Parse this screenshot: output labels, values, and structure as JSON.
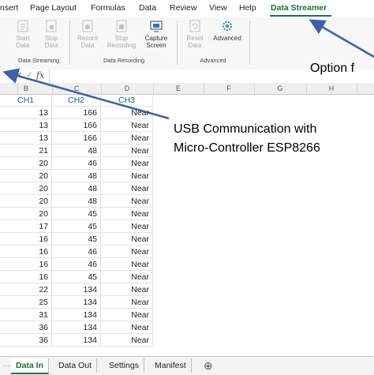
{
  "menu": [
    "nsert",
    "Page Layout",
    "Formulas",
    "Data",
    "Review",
    "View",
    "Help",
    "Data Streamer"
  ],
  "ribbon": {
    "buttons": [
      "Start\nData",
      "Stop\nData",
      "Record\nData",
      "Stop\nRecording",
      "Capture\nScreen",
      "Reset\nData",
      "Advanced"
    ],
    "groups": [
      "Data Streaming",
      "Data Recording",
      "Advanced"
    ]
  },
  "formula_bar": {
    "fx": "fx"
  },
  "columns": [
    "B",
    "C",
    "D",
    "E",
    "F",
    "G",
    "H"
  ],
  "table": {
    "headers": [
      "CH1",
      "CH2",
      "CH3"
    ],
    "rows": [
      [
        "13",
        "166",
        "Near"
      ],
      [
        "13",
        "166",
        "Near"
      ],
      [
        "13",
        "166",
        "Near"
      ],
      [
        "21",
        "48",
        "Near"
      ],
      [
        "20",
        "46",
        "Near"
      ],
      [
        "20",
        "48",
        "Near"
      ],
      [
        "20",
        "48",
        "Near"
      ],
      [
        "20",
        "48",
        "Near"
      ],
      [
        "20",
        "45",
        "Near"
      ],
      [
        "17",
        "45",
        "Near"
      ],
      [
        "16",
        "45",
        "Near"
      ],
      [
        "16",
        "46",
        "Near"
      ],
      [
        "16",
        "46",
        "Near"
      ],
      [
        "16",
        "45",
        "Near"
      ],
      [
        "22",
        "134",
        "Near"
      ],
      [
        "25",
        "134",
        "Near"
      ],
      [
        "31",
        "134",
        "Near"
      ],
      [
        "36",
        "134",
        "Near"
      ],
      [
        "36",
        "134",
        "Near"
      ]
    ]
  },
  "sheet_tabs": [
    "Data In",
    "Data Out",
    "Settings",
    "Manifest"
  ],
  "annotations": {
    "option": "Option f",
    "usb_line1": "USB Communication with",
    "usb_line2": "Micro-Controller ESP8266"
  },
  "colors": {
    "accent": "#217346",
    "arrow": "#3f5fa8"
  }
}
